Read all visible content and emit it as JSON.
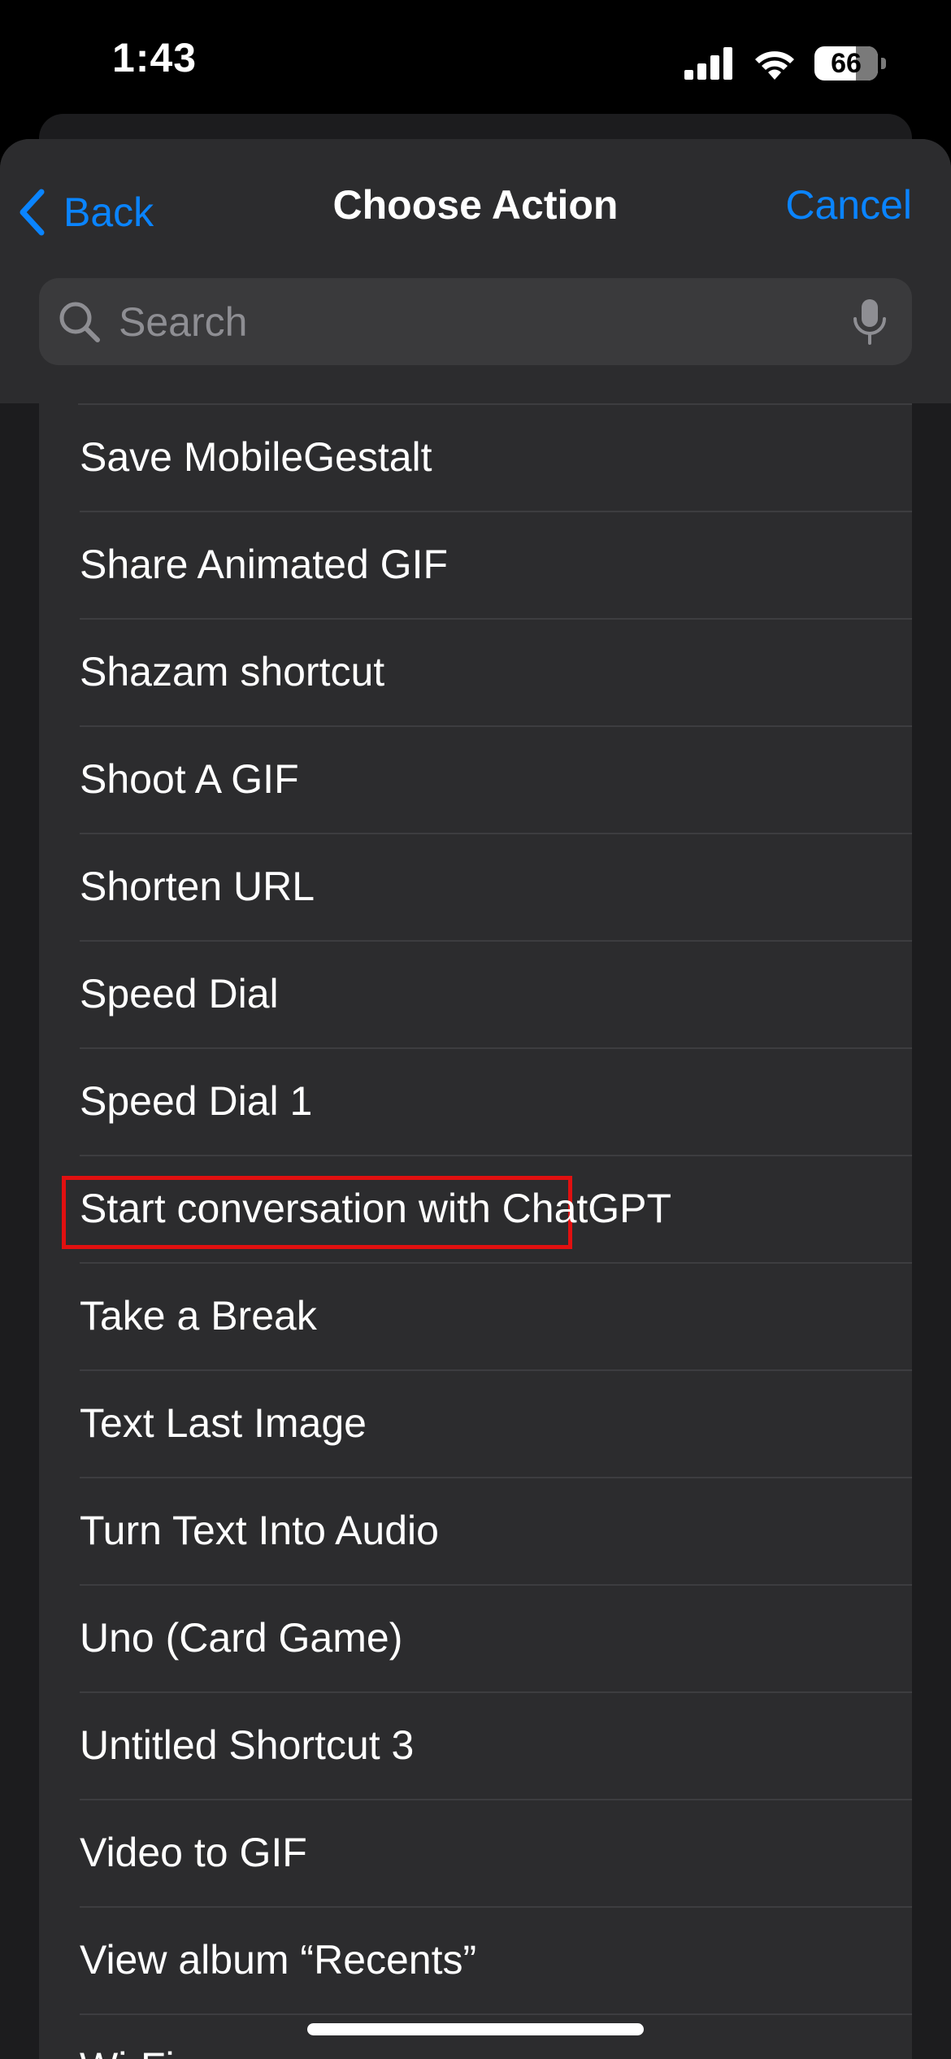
{
  "status_bar": {
    "time": "1:43",
    "battery": "66",
    "icons": [
      "cellular-signal-icon",
      "wifi-icon",
      "battery-icon"
    ]
  },
  "nav": {
    "back_label": "Back",
    "title": "Choose Action",
    "cancel_label": "Cancel"
  },
  "search": {
    "placeholder": "Search",
    "value": ""
  },
  "colors": {
    "accent": "#0a84ff",
    "highlight": "#e11010",
    "sheet_background": "#2c2c2e"
  },
  "list": {
    "items": [
      {
        "label": "Save MobileGestalt"
      },
      {
        "label": "Share Animated GIF"
      },
      {
        "label": "Shazam shortcut"
      },
      {
        "label": "Shoot A GIF"
      },
      {
        "label": "Shorten URL"
      },
      {
        "label": "Speed Dial"
      },
      {
        "label": "Speed Dial 1"
      },
      {
        "label": "Start conversation with ChatGPT",
        "highlighted": true
      },
      {
        "label": "Take a Break"
      },
      {
        "label": "Text Last Image"
      },
      {
        "label": "Turn Text Into Audio"
      },
      {
        "label": "Uno (Card Game)"
      },
      {
        "label": "Untitled Shortcut 3"
      },
      {
        "label": "Video to GIF"
      },
      {
        "label": "View album “Recents”"
      },
      {
        "label": "Wi-Fi"
      }
    ]
  }
}
